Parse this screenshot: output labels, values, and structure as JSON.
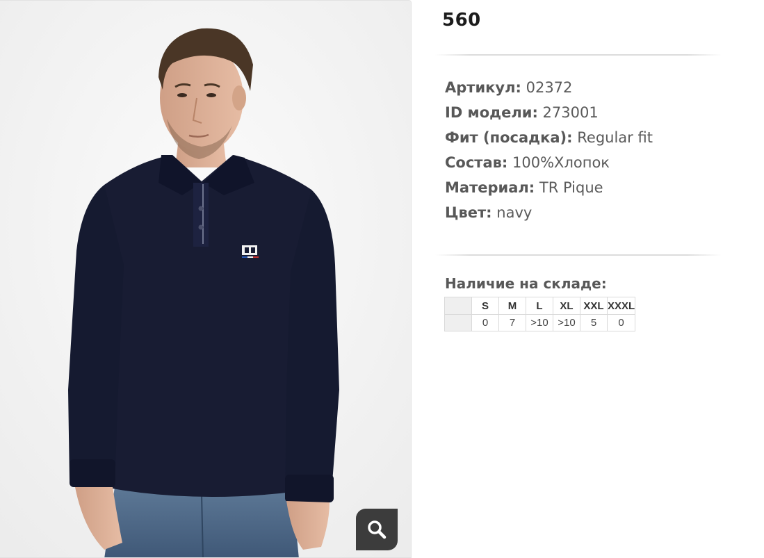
{
  "product": {
    "price": "560",
    "photo_alt": "Мужское поло с длинным рукавом navy"
  },
  "specs": [
    {
      "label": "Артикул:",
      "value": "02372"
    },
    {
      "label": "ID модели:",
      "value": "273001"
    },
    {
      "label": "Фит (посадка):",
      "value": "Regular fit"
    },
    {
      "label": "Состав:",
      "value": "100%Хлопок"
    },
    {
      "label": "Материал:",
      "value": "TR Pique"
    },
    {
      "label": "Цвет:",
      "value": "navy"
    }
  ],
  "stock": {
    "title": "Наличие на складе:",
    "sizes": [
      "S",
      "M",
      "L",
      "XL",
      "XXL",
      "XXXL"
    ],
    "quantities": [
      "0",
      "7",
      ">10",
      ">10",
      "5",
      "0"
    ]
  },
  "icons": {
    "zoom": "search-icon"
  },
  "colors": {
    "shirt": "#181c33",
    "zoom_button": "#3c3c3c",
    "text": "#5a5a5a"
  }
}
